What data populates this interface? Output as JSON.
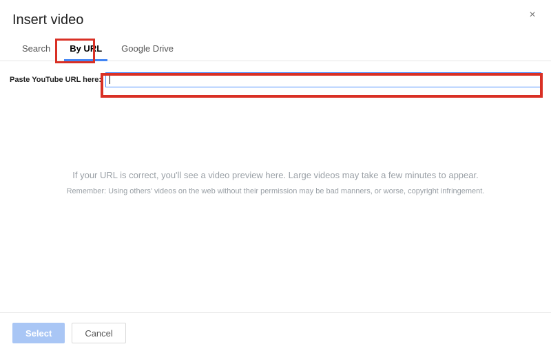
{
  "dialog": {
    "title": "Insert video",
    "close_label": "×"
  },
  "tabs": {
    "search": "Search",
    "by_url": "By URL",
    "drive": "Google Drive"
  },
  "url": {
    "label": "Paste YouTube URL here:",
    "value": ""
  },
  "hints": {
    "preview": "If your URL is correct, you'll see a video preview here. Large videos may take a few minutes to appear.",
    "permission": "Remember: Using others' videos on the web without their permission may be bad manners, or worse, copyright infringement."
  },
  "footer": {
    "select": "Select",
    "cancel": "Cancel"
  }
}
